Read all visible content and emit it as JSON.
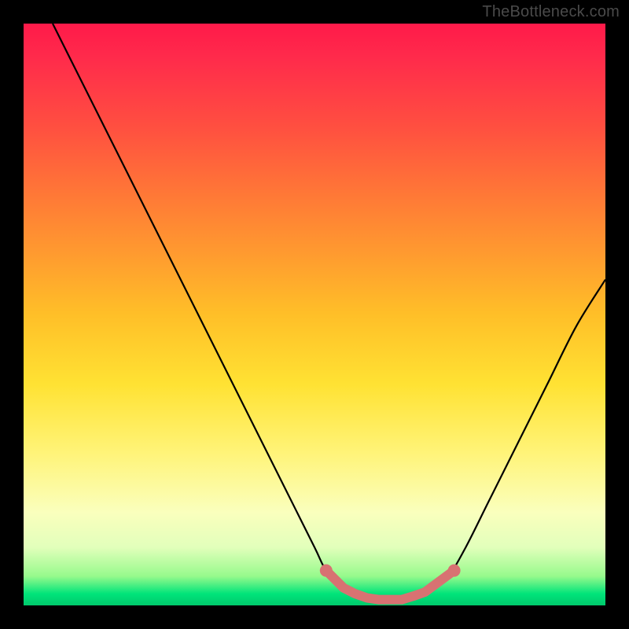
{
  "watermark": "TheBottleneck.com",
  "colors": {
    "curve_stroke": "#000000",
    "marker_fill": "#d87272",
    "marker_stroke": "#d87272"
  },
  "chart_data": {
    "type": "line",
    "title": "",
    "xlabel": "",
    "ylabel": "",
    "xlim": [
      0,
      100
    ],
    "ylim": [
      0,
      100
    ],
    "grid": false,
    "legend": false,
    "series": [
      {
        "name": "curve",
        "x": [
          5,
          10,
          15,
          20,
          25,
          30,
          35,
          40,
          45,
          50,
          52,
          55,
          58,
          60,
          62,
          65,
          68,
          70,
          73,
          76,
          80,
          85,
          90,
          95,
          100
        ],
        "y": [
          100,
          90,
          80,
          70,
          60,
          50,
          40,
          30,
          20,
          10,
          6,
          3,
          1.5,
          1,
          1,
          1,
          1.5,
          2.5,
          5,
          10,
          18,
          28,
          38,
          48,
          56
        ]
      }
    ],
    "markers": [
      {
        "x": 52,
        "y": 6
      },
      {
        "x": 55,
        "y": 3
      },
      {
        "x": 57,
        "y": 2
      },
      {
        "x": 59,
        "y": 1.3
      },
      {
        "x": 61,
        "y": 1
      },
      {
        "x": 63,
        "y": 1
      },
      {
        "x": 65,
        "y": 1
      },
      {
        "x": 67,
        "y": 1.6
      },
      {
        "x": 69,
        "y": 2.3
      },
      {
        "x": 74,
        "y": 6
      }
    ]
  }
}
